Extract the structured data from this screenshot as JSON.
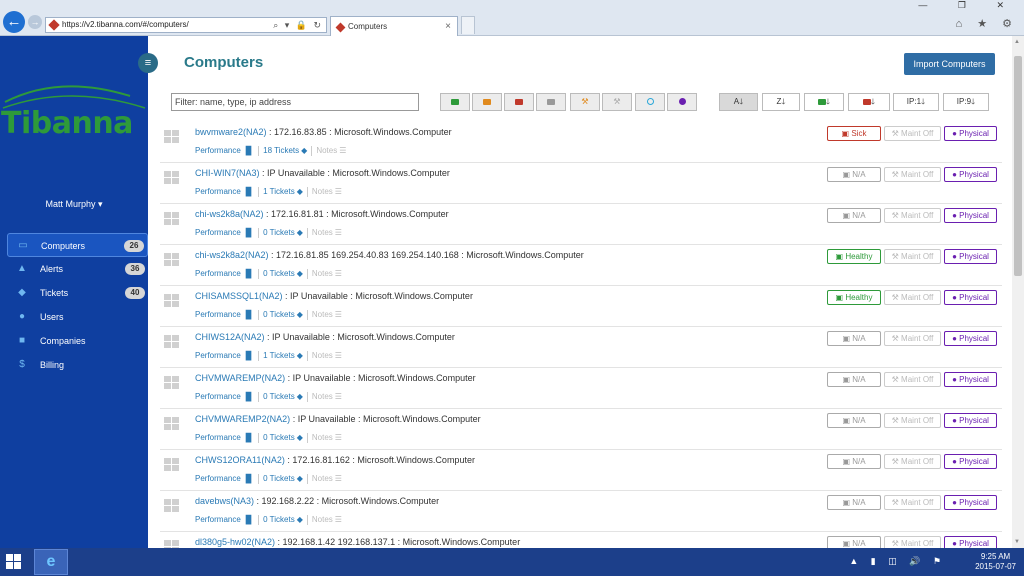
{
  "browser": {
    "url": "https://v2.tibanna.com/#/computers/",
    "tab_title": "Computers",
    "address_icons": "⌕ ▾ 🔒 ↻",
    "window_controls": "— ❐ ✕",
    "chrome_icons": "⌂ ★ ⚙"
  },
  "sidebar": {
    "logo": "Tibanna",
    "user": "Matt Murphy ▾",
    "items": [
      {
        "label": "Computers",
        "icon": "laptop-icon",
        "badge": "26",
        "active": true
      },
      {
        "label": "Alerts",
        "icon": "warning-icon",
        "badge": "36"
      },
      {
        "label": "Tickets",
        "icon": "tag-icon",
        "badge": "40"
      },
      {
        "label": "Users",
        "icon": "user-icon",
        "badge": ""
      },
      {
        "label": "Companies",
        "icon": "briefcase-icon",
        "badge": ""
      },
      {
        "label": "Billing",
        "icon": "dollar-icon",
        "badge": ""
      }
    ]
  },
  "main": {
    "title": "Computers",
    "import_label": "Import Computers",
    "filter_placeholder": "Filter: name, type, ip address",
    "sort_buttons": [
      {
        "label": "A",
        "arrow": "🡓"
      },
      {
        "label": "Z",
        "arrow": "🡓"
      },
      {
        "label": "",
        "arrow": "🡓",
        "icon": "green"
      },
      {
        "label": "",
        "arrow": "🡓",
        "icon": "red"
      },
      {
        "label": "IP:1",
        "arrow": "🡓"
      },
      {
        "label": "IP:9",
        "arrow": "🡓"
      }
    ],
    "labels": {
      "performance": "Performance",
      "notes": "Notes",
      "maint_off": "Maint Off",
      "physical": "Physical"
    },
    "rows": [
      {
        "name": "bwvmware2(NA2)",
        "details": " : 172.16.83.85 : Microsoft.Windows.Computer",
        "tickets": "18 Tickets",
        "status": "Sick",
        "status_type": "sick"
      },
      {
        "name": "CHI-WIN7(NA3)",
        "details": " : IP Unavailable : Microsoft.Windows.Computer",
        "tickets": "1 Tickets",
        "status": "N/A",
        "status_type": "na"
      },
      {
        "name": "chi-ws2k8a(NA2)",
        "details": " : 172.16.81.81 : Microsoft.Windows.Computer",
        "tickets": "0 Tickets",
        "status": "N/A",
        "status_type": "na"
      },
      {
        "name": "chi-ws2k8a2(NA2)",
        "details": " : 172.16.81.85 169.254.40.83 169.254.140.168 : Microsoft.Windows.Computer",
        "tickets": "0 Tickets",
        "status": "Healthy",
        "status_type": "healthy"
      },
      {
        "name": "CHISAMSSQL1(NA2)",
        "details": " : IP Unavailable : Microsoft.Windows.Computer",
        "tickets": "0 Tickets",
        "status": "Healthy",
        "status_type": "healthy"
      },
      {
        "name": "CHIWS12A(NA2)",
        "details": " : IP Unavailable : Microsoft.Windows.Computer",
        "tickets": "1 Tickets",
        "status": "N/A",
        "status_type": "na"
      },
      {
        "name": "CHVMWAREMP(NA2)",
        "details": " : IP Unavailable : Microsoft.Windows.Computer",
        "tickets": "0 Tickets",
        "status": "N/A",
        "status_type": "na"
      },
      {
        "name": "CHVMWAREMP2(NA2)",
        "details": " : IP Unavailable : Microsoft.Windows.Computer",
        "tickets": "0 Tickets",
        "status": "N/A",
        "status_type": "na"
      },
      {
        "name": "CHWS12ORA11(NA2)",
        "details": " : 172.16.81.162 : Microsoft.Windows.Computer",
        "tickets": "0 Tickets",
        "status": "N/A",
        "status_type": "na"
      },
      {
        "name": "davebws(NA3)",
        "details": " : 192.168.2.22 : Microsoft.Windows.Computer",
        "tickets": "0 Tickets",
        "status": "N/A",
        "status_type": "na"
      },
      {
        "name": "dl380g5-hw02(NA2)",
        "details": " : 192.168.1.42 192.168.137.1 : Microsoft.Windows.Computer",
        "tickets": "",
        "status": "N/A",
        "status_type": "na"
      }
    ]
  },
  "taskbar": {
    "time": "9:25 AM",
    "date": "2015-07-07",
    "tray_icons": "▲ ▮ ◫ 🔊 ⚑"
  },
  "colors": {
    "sidebar_bg": "#0f3fa0",
    "accent": "#2a7ab5",
    "title": "#2a7a8a",
    "sick": "#c0392b",
    "healthy": "#2e9a3a",
    "physical": "#6a1fb0"
  }
}
